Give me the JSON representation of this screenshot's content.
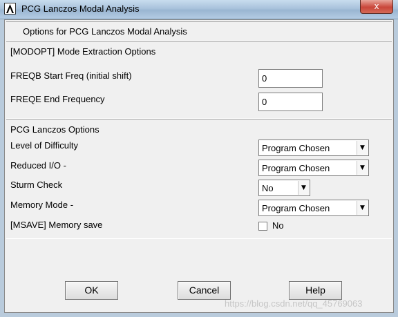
{
  "window": {
    "title": "PCG Lanczos Modal Analysis",
    "close_glyph": "x"
  },
  "header": {
    "title": "Options for PCG Lanczos Modal Analysis"
  },
  "modopt": {
    "section_label": "[MODOPT]  Mode Extraction Options",
    "freqb_label": "FREQB Start Freq (initial shift)",
    "freqb_value": "0",
    "freqe_label": "FREQE End Frequency",
    "freqe_value": "0"
  },
  "pcg": {
    "section_label": "PCG Lanczos Options",
    "difficulty_label": "Level of Difficulty",
    "difficulty_value": "Program Chosen",
    "reduced_io_label": "Reduced I/O -",
    "reduced_io_value": "Program Chosen",
    "sturm_label": "Sturm Check",
    "sturm_value": "No",
    "memory_mode_label": "Memory Mode -",
    "memory_mode_value": "Program Chosen",
    "msave_label": "[MSAVE]  Memory save",
    "msave_checked": false,
    "msave_state_text": "No"
  },
  "buttons": {
    "ok": "OK",
    "cancel": "Cancel",
    "help": "Help"
  },
  "watermark": "https://blog.csdn.net/qq_45769063",
  "icons": {
    "app": "ansys-a-logo-icon",
    "close": "close-icon",
    "dropdown": "chevron-down-icon",
    "checkbox": "checkbox-icon"
  }
}
